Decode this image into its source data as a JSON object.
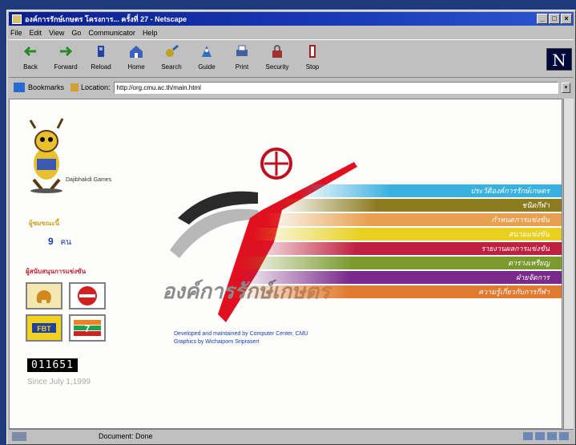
{
  "window": {
    "title": "องค์การรักษ์เกษตร โครงการ... ครั้งที่ 27 - Netscape",
    "buttons": [
      "_",
      "□",
      "×"
    ]
  },
  "menubar": [
    "File",
    "Edit",
    "View",
    "Go",
    "Communicator",
    "Help"
  ],
  "toolbar": [
    {
      "label": "Back",
      "icon": "back-arrow-icon",
      "color": "#2a8a2a"
    },
    {
      "label": "Forward",
      "icon": "forward-arrow-icon",
      "color": "#2a8a2a"
    },
    {
      "label": "Reload",
      "icon": "reload-icon",
      "color": "#2a40a0"
    },
    {
      "label": "Home",
      "icon": "home-icon",
      "color": "#3a60c0"
    },
    {
      "label": "Search",
      "icon": "search-icon",
      "color": "#c0a020"
    },
    {
      "label": "Guide",
      "icon": "guide-icon",
      "color": "#3070c0"
    },
    {
      "label": "Print",
      "icon": "print-icon",
      "color": "#4060a0"
    },
    {
      "label": "Security",
      "icon": "security-icon",
      "color": "#a03030"
    },
    {
      "label": "Stop",
      "icon": "stop-icon",
      "color": "#a02020"
    }
  ],
  "netscape_logo": "N",
  "location": {
    "bookmarks_label": "Bookmarks",
    "location_label": "Location:",
    "url": "http://org.cmu.ac.th/main.html"
  },
  "page": {
    "mascot_caption": "Dajibhakdi Games",
    "visitor_label": "ผู้ชมขณะนี้",
    "visitor_count": "9",
    "visitor_unit": "คน",
    "sponsor_label": "ผู้สนับสนุนการแข่งขัน",
    "counter": "011651",
    "since": "Since July 1,1999",
    "logo_text": "องค์การรักษ์เกษตร",
    "credit_line1": "Developed and maintained by Computer Center, CMU",
    "credit_line2": "Graphics by Wichaiporn Sriprasert",
    "menu": [
      {
        "label": "ประวัติองค์การรักษ์เกษตร",
        "color": "#3ab0e0"
      },
      {
        "label": "ชนิดกีฬา",
        "color": "#8a7a20"
      },
      {
        "label": "กำหนดการแข่งขัน",
        "color": "#e8a050"
      },
      {
        "label": "สนามแข่งขัน",
        "color": "#e8d020"
      },
      {
        "label": "รายงานผลการแข่งขัน",
        "color": "#c02040"
      },
      {
        "label": "ตารางเหรียญ",
        "color": "#7a9a30"
      },
      {
        "label": "ฝ่ายจัดการ",
        "color": "#7a2a8a"
      },
      {
        "label": "ความรู้เกี่ยวกับการกีฬา",
        "color": "#e07a30"
      }
    ]
  },
  "status": {
    "text": "Document: Done"
  }
}
